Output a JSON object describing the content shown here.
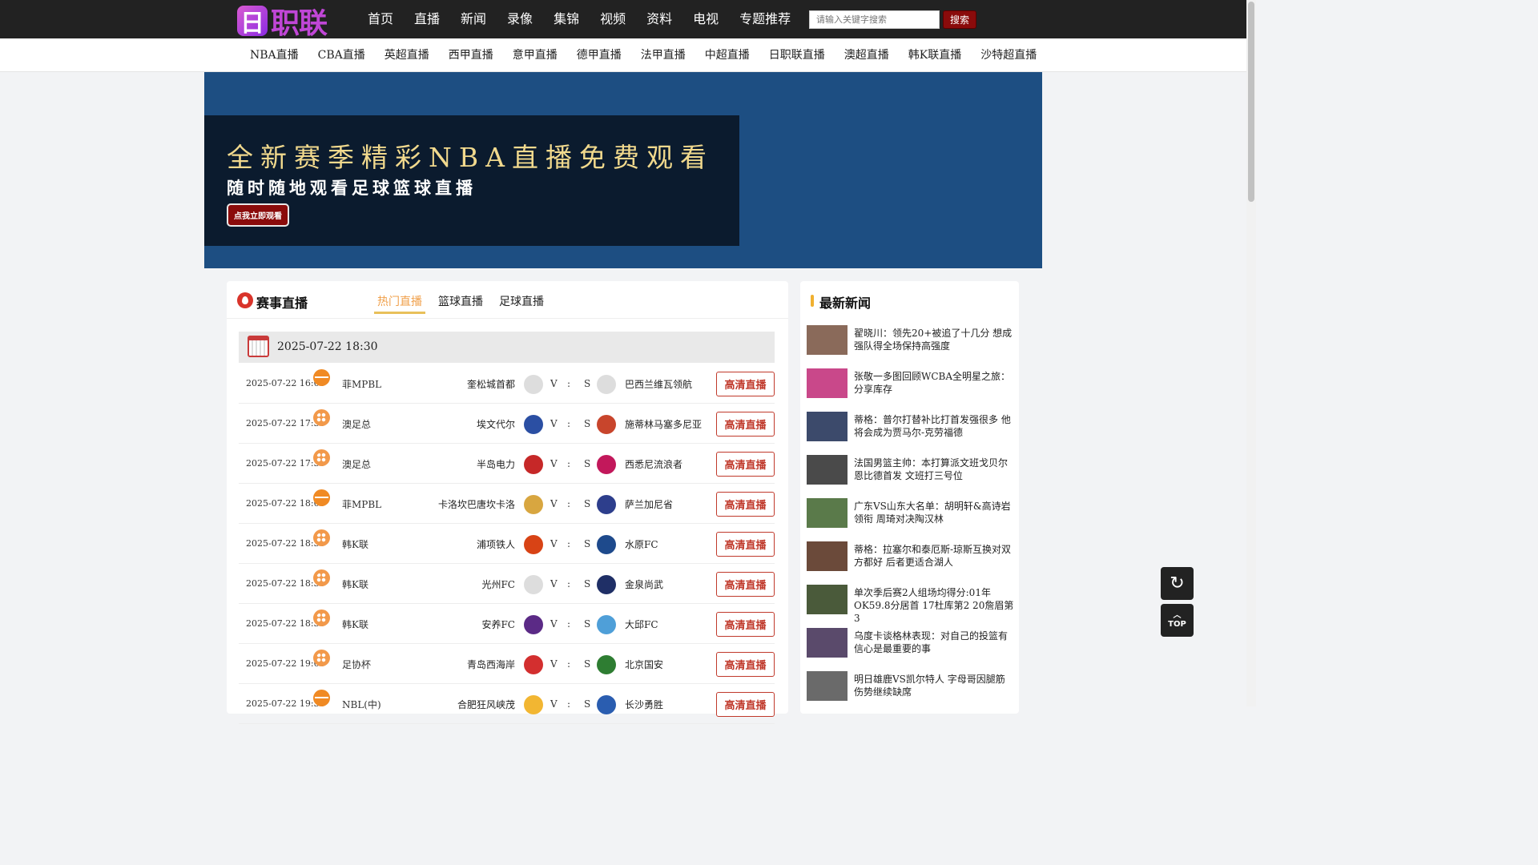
{
  "site": {
    "logo_char": "日",
    "logo_text": "职联"
  },
  "main_nav": [
    "首页",
    "直播",
    "新闻",
    "录像",
    "集锦",
    "视频",
    "资料",
    "电视",
    "专题推荐"
  ],
  "search": {
    "placeholder": "请输入关键字搜索",
    "button": "搜索"
  },
  "sub_nav": [
    "NBA直播",
    "CBA直播",
    "英超直播",
    "西甲直播",
    "意甲直播",
    "德甲直播",
    "法甲直播",
    "中超直播",
    "日职联直播",
    "澳超直播",
    "韩K联直播",
    "沙特超直播"
  ],
  "banner": {
    "headline": "全新赛季精彩NBA直播免费观看",
    "subline": "随时随地观看足球篮球直播",
    "button": "点我立即观看"
  },
  "schedule": {
    "title": "赛事直播",
    "tabs": [
      {
        "label": "热门直播",
        "active": true
      },
      {
        "label": "篮球直播",
        "active": false
      },
      {
        "label": "足球直播",
        "active": false
      }
    ],
    "date": "2025-07-22 18:30",
    "versus": "V",
    "colon": ":",
    "score_mark": "S",
    "button_label": "高清直播",
    "matches": [
      {
        "time": "2025-07-22 16:00",
        "sport": "basketball-icon",
        "league": "菲MPBL",
        "home": "奎松城首都",
        "away": "巴西兰维瓦领航",
        "home_color": "#dddddd",
        "away_color": "#dddddd"
      },
      {
        "time": "2025-07-22 17:30",
        "sport": "football-icon",
        "league": "澳足总",
        "home": "埃文代尔",
        "away": "施蒂林马塞多尼亚",
        "home_color": "#2b4fa3",
        "away_color": "#c8452c"
      },
      {
        "time": "2025-07-22 17:30",
        "sport": "football-icon",
        "league": "澳足总",
        "home": "半岛电力",
        "away": "西悉尼流浪者",
        "home_color": "#c62828",
        "away_color": "#c2185b"
      },
      {
        "time": "2025-07-22 18:00",
        "sport": "basketball-icon",
        "league": "菲MPBL",
        "home": "卡洛坎巴唐坎卡洛",
        "away": "萨兰加尼省",
        "home_color": "#d8a640",
        "away_color": "#2d3e8c"
      },
      {
        "time": "2025-07-22 18:30",
        "sport": "football-icon",
        "league": "韩K联",
        "home": "浦项铁人",
        "away": "水原FC",
        "home_color": "#d84315",
        "away_color": "#1e4a8c"
      },
      {
        "time": "2025-07-22 18:30",
        "sport": "football-icon",
        "league": "韩K联",
        "home": "光州FC",
        "away": "金泉尚武",
        "home_color": "#dddddd",
        "away_color": "#1f2f66"
      },
      {
        "time": "2025-07-22 18:30",
        "sport": "football-icon",
        "league": "韩K联",
        "home": "安养FC",
        "away": "大邱FC",
        "home_color": "#5b2a86",
        "away_color": "#4f9fd8"
      },
      {
        "time": "2025-07-22 19:00",
        "sport": "football-icon",
        "league": "足协杯",
        "home": "青岛西海岸",
        "away": "北京国安",
        "home_color": "#d32f2f",
        "away_color": "#2e7d32"
      },
      {
        "time": "2025-07-22 19:30",
        "sport": "basketball-icon",
        "league": "NBL(中)",
        "home": "合肥狂风峡茂",
        "away": "长沙勇胜",
        "home_color": "#f2b632",
        "away_color": "#2a5db0"
      }
    ]
  },
  "news": {
    "title": "最新新闻",
    "items": [
      {
        "text": "翟晓川：领先20+被追了十几分 想成强队得全场保持高强度",
        "thumb": "#8a6a5a"
      },
      {
        "text": "张敬一多图回顾WCBA全明星之旅：分享库存",
        "thumb": "#c9488a"
      },
      {
        "text": "蒂格：普尔打替补比打首发强很多 他将会成为贾马尔-克劳福德",
        "thumb": "#3c4a6b"
      },
      {
        "text": "法国男篮主帅：本打算派文班戈贝尔恩比德首发 文班打三号位",
        "thumb": "#4a4a4a"
      },
      {
        "text": "广东VS山东大名单：胡明轩&高诗岩领衔 周琦对决陶汉林",
        "thumb": "#5a7a4a"
      },
      {
        "text": "蒂格：拉塞尔和泰厄斯-琼斯互换对双方都好 后者更适合湖人",
        "thumb": "#6b4a3a"
      },
      {
        "text": "单次季后赛2人组场均得分:01年OK59.8分居首 17杜库第2 20詹眉第3",
        "thumb": "#4a5a3a"
      },
      {
        "text": "乌度卡谈格林表现：对自己的投篮有信心是最重要的事",
        "thumb": "#5a4a6b"
      },
      {
        "text": "明日雄鹿VS凯尔特人 字母哥因腿筋伤势继续缺席",
        "thumb": "#6a6a6a"
      }
    ]
  },
  "float": {
    "refresh_icon": "↻",
    "top_label": "TOP",
    "top_arrow": "︿"
  }
}
